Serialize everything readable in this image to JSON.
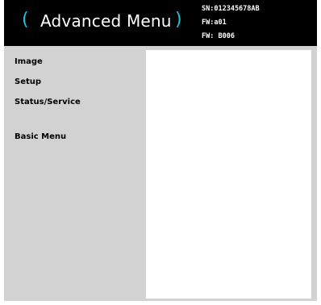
{
  "header": {
    "title": "Advanced Menu",
    "paren_open": "(",
    "paren_close": ")",
    "serial": "SN:012345678AB",
    "firmware_1": "FW:a01",
    "firmware_2": "FW: B006"
  },
  "sidebar": {
    "items": [
      {
        "label": "Image"
      },
      {
        "label": "Setup"
      },
      {
        "label": "Status/Service"
      },
      {
        "label": "Basic Menu"
      }
    ]
  },
  "colors": {
    "header_bg": "#000000",
    "accent_paren": "#19c6d8",
    "frame_bg": "#d2d2d2",
    "panel_bg": "#ffffff"
  }
}
